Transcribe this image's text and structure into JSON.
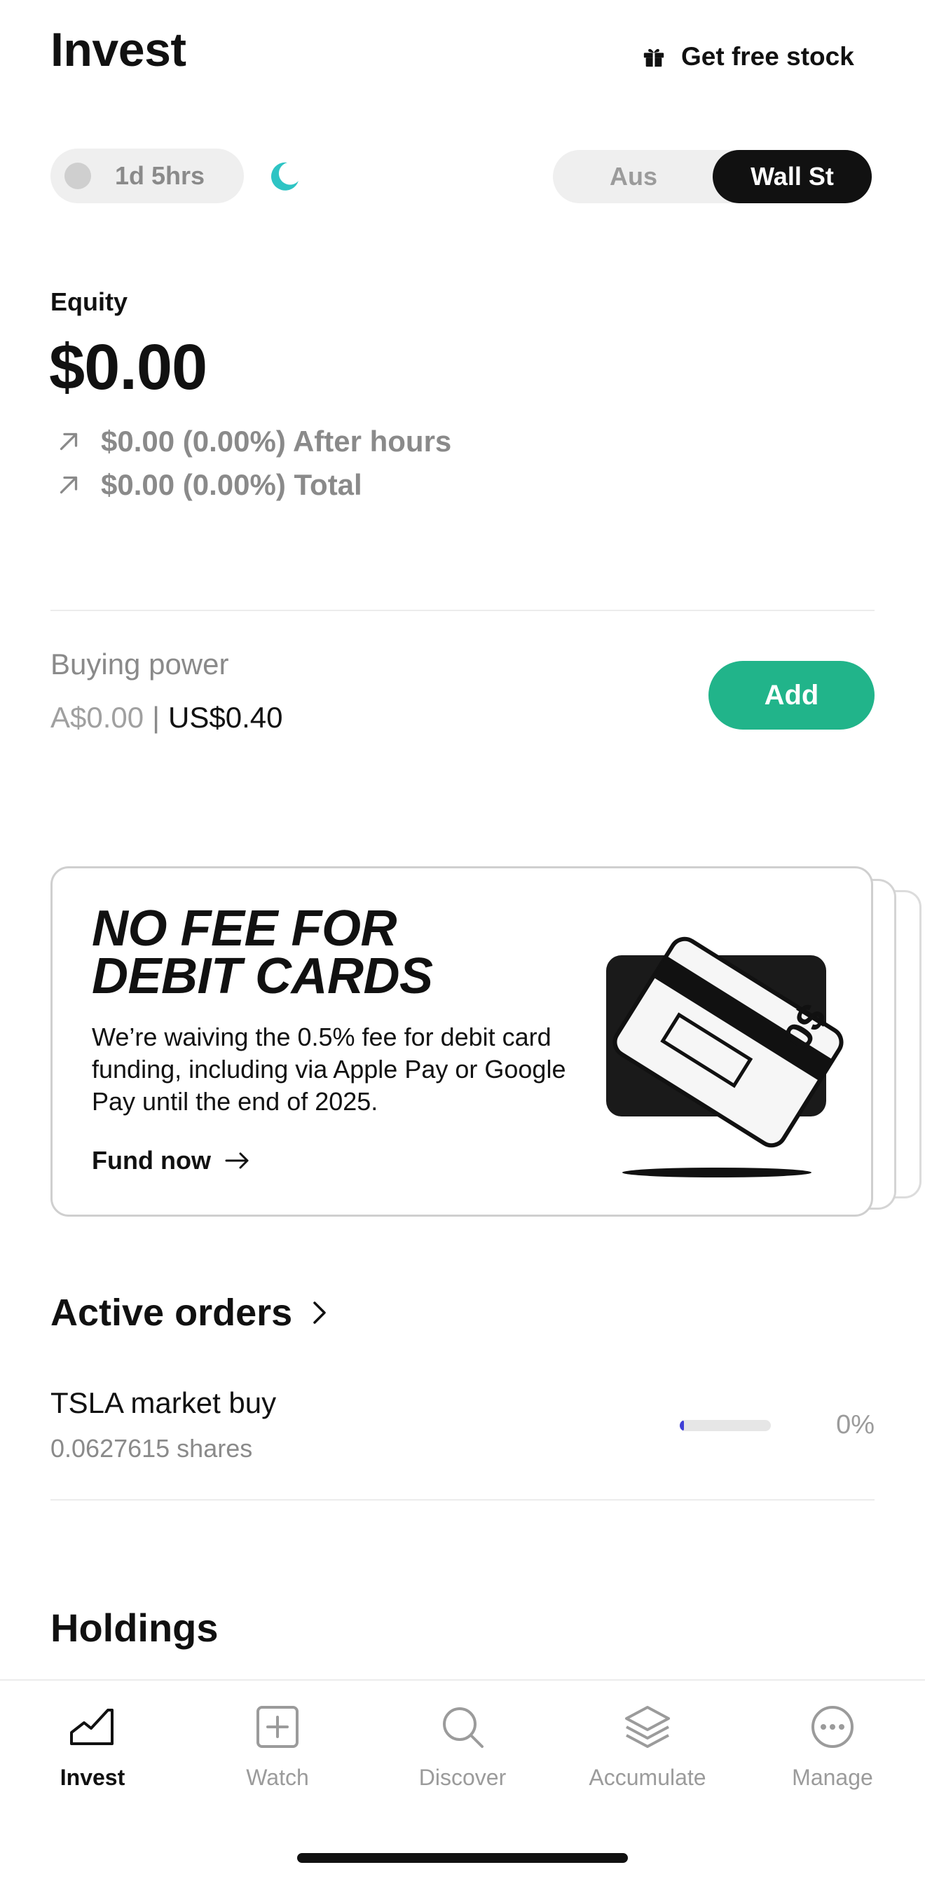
{
  "header": {
    "title": "Invest",
    "free_stock_label": "Get free stock"
  },
  "session": {
    "time_label": "1d 5hrs"
  },
  "market_toggle": {
    "options": [
      "Aus",
      "Wall St"
    ],
    "selected": "Wall St"
  },
  "equity": {
    "label": "Equity",
    "value": "$0.00",
    "after_hours": "$0.00 (0.00%) After hours",
    "total": "$0.00 (0.00%) Total"
  },
  "buying_power": {
    "label": "Buying power",
    "aud": "A$0.00",
    "separator": "|",
    "usd": "US$0.40",
    "add_label": "Add"
  },
  "promo": {
    "title_line1": "NO FEE FOR",
    "title_line2": "DEBIT CARDS",
    "body": "We’re waiving the 0.5% fee for debit card funding, including via Apple Pay or Google Pay until the end of 2025.",
    "link_label": "Fund now",
    "card_text": "$0"
  },
  "active_orders": {
    "title": "Active orders",
    "orders": [
      {
        "name": "TSLA market buy",
        "shares": "0.0627615 shares",
        "progress_pct_label": "0%",
        "progress_fraction": 0.04
      }
    ]
  },
  "holdings": {
    "title": "Holdings"
  },
  "bottom_nav": {
    "items": [
      {
        "label": "Invest",
        "icon": "chart-icon",
        "active": true
      },
      {
        "label": "Watch",
        "icon": "plus-square-icon",
        "active": false
      },
      {
        "label": "Discover",
        "icon": "search-icon",
        "active": false
      },
      {
        "label": "Accumulate",
        "icon": "layers-icon",
        "active": false
      },
      {
        "label": "Manage",
        "icon": "more-icon",
        "active": false
      }
    ]
  },
  "colors": {
    "accent_green": "#21b48a",
    "moon_teal": "#2ec4c4",
    "progress_blue": "#3f3fd6",
    "dark": "#111111",
    "muted": "#8a8a8a"
  }
}
